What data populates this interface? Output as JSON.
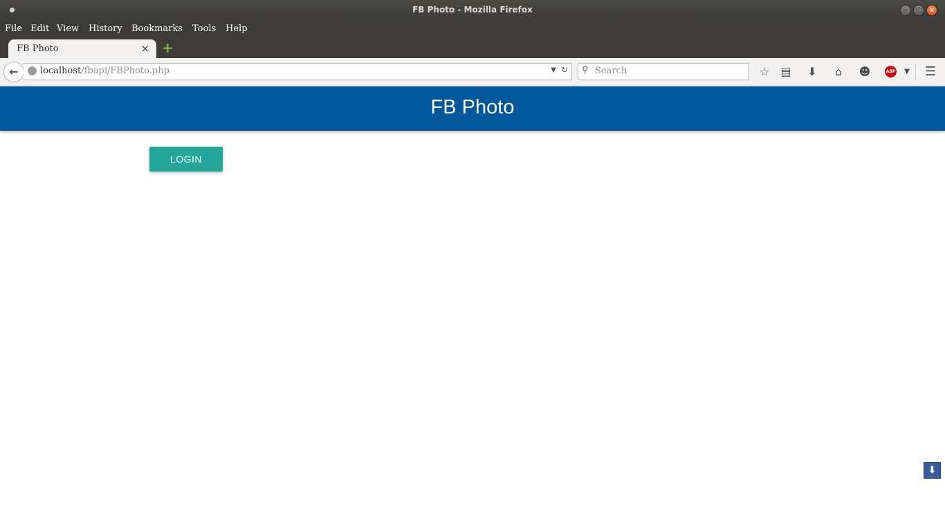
{
  "window": {
    "title": "FB Photo - Mozilla Firefox"
  },
  "menu": {
    "items": [
      "File",
      "Edit",
      "View",
      "History",
      "Bookmarks",
      "Tools",
      "Help"
    ]
  },
  "tabs": [
    {
      "label": "FB Photo",
      "close": "×"
    }
  ],
  "new_tab_glyph": "+",
  "url": {
    "host": "localhost",
    "path": "/fbapi/FBPhoto.php"
  },
  "search": {
    "placeholder": "Search"
  },
  "toolbar_icons": [
    "star-icon",
    "reading-list-icon",
    "download-icon",
    "home-icon",
    "hello-icon",
    "adblock-icon",
    "menu-icon"
  ],
  "adblock_label": "ABP",
  "page": {
    "header_title": "FB Photo",
    "login_label": "LOGIN"
  },
  "colors": {
    "header": "#01579b",
    "login_button": "#26a69a",
    "titlebar": "#3d3c38"
  }
}
